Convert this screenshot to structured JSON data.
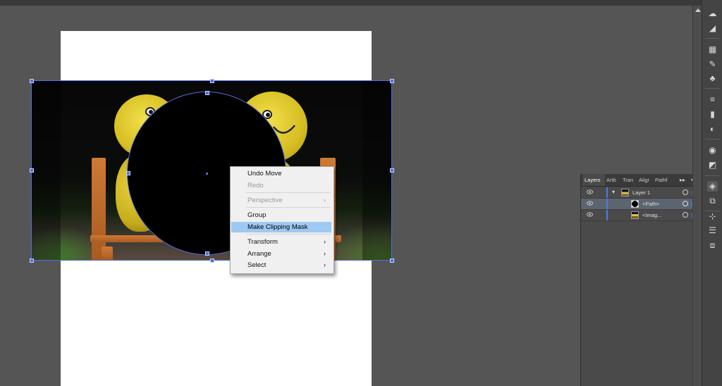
{
  "canvas": {
    "artboard_color": "#ffffff",
    "workspace_color": "#555555"
  },
  "context_menu": {
    "items": [
      {
        "label": "Undo Move",
        "enabled": true
      },
      {
        "label": "Redo",
        "enabled": false
      },
      {
        "label": "Perspective",
        "enabled": false,
        "submenu": true
      },
      {
        "label": "Group",
        "enabled": true
      },
      {
        "label": "Make Clipping Mask",
        "enabled": true,
        "highlighted": true
      },
      {
        "label": "Transform",
        "enabled": true,
        "submenu": true
      },
      {
        "label": "Arrange",
        "enabled": true,
        "submenu": true
      },
      {
        "label": "Select",
        "enabled": true,
        "submenu": true
      }
    ],
    "submenu_arrow": "›"
  },
  "layers_panel": {
    "tabs": [
      "Layers",
      "Artb",
      "Tran",
      "Aligr",
      "Pathf"
    ],
    "active_tab": "Layers",
    "collapse_button": "▸▸",
    "menu_button": "▾≡",
    "rows": [
      {
        "name": "Layer 1",
        "icon": "layer-thumb",
        "expanded": true
      },
      {
        "name": "<Path>",
        "icon": "path-thumb",
        "selected": true
      },
      {
        "name": "<Imag...",
        "icon": "image-thumb"
      }
    ]
  },
  "toolbar": {
    "icons": [
      "libraries-icon",
      "color-guide-icon",
      "artboards-icon",
      "brushes-icon",
      "symbols-icon",
      "stroke-icon",
      "gradient-icon",
      "transparency-icon",
      "appearance-icon",
      "graphic-styles-icon",
      "layers-icon",
      "artboard-nav-icon",
      "transform-icon",
      "align-icon",
      "pathfinder-icon"
    ]
  },
  "colors": {
    "selection": "#4c6fe0",
    "menu_highlight": "#9ec9f2",
    "panel_bg": "#4a4a4a"
  }
}
